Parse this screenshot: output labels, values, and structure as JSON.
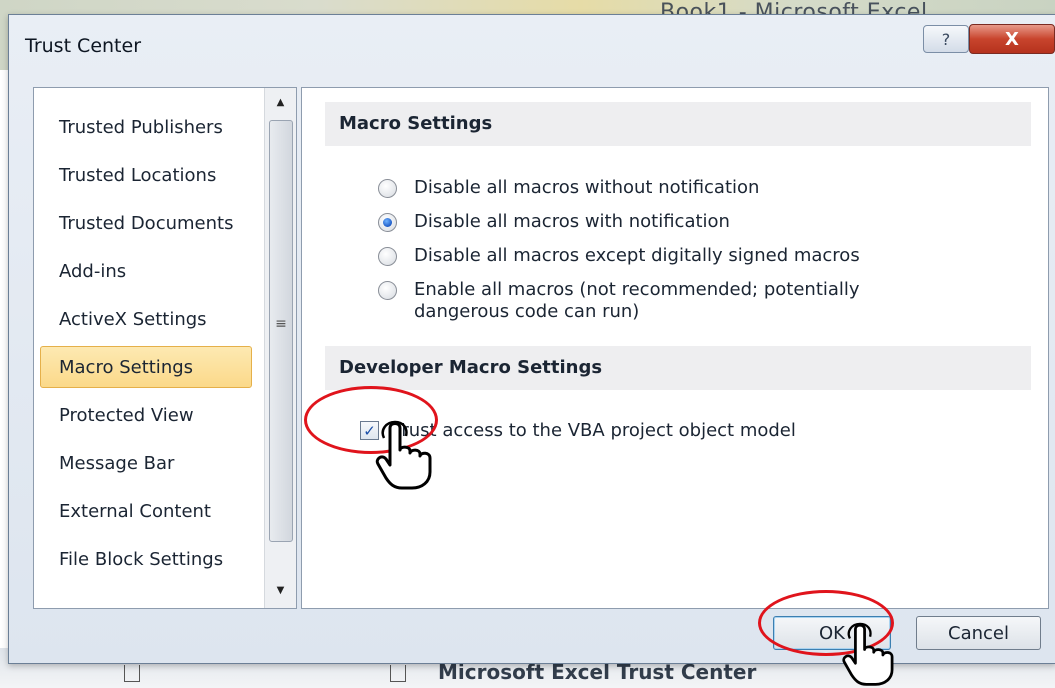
{
  "background": {
    "app_title": "Book1 - Microsoft Excel",
    "bottom_title": "Microsoft Excel Trust Center"
  },
  "dialog": {
    "title": "Trust Center",
    "help_label": "?",
    "close_label": "X"
  },
  "nav": {
    "items": [
      {
        "label": "Trusted Publishers"
      },
      {
        "label": "Trusted Locations"
      },
      {
        "label": "Trusted Documents"
      },
      {
        "label": "Add-ins"
      },
      {
        "label": "ActiveX Settings"
      },
      {
        "label": "Macro Settings"
      },
      {
        "label": "Protected View"
      },
      {
        "label": "Message Bar"
      },
      {
        "label": "External Content"
      },
      {
        "label": "File Block Settings"
      }
    ],
    "selected_index": 5
  },
  "panel": {
    "macro_header": "Macro Settings",
    "macro_options": [
      {
        "label": "Disable all macros without notification",
        "checked": false
      },
      {
        "label": "Disable all macros with notification",
        "checked": true
      },
      {
        "label": "Disable all macros except digitally signed macros",
        "checked": false
      },
      {
        "label": "Enable all macros (not recommended; potentially dangerous code can run)",
        "checked": false
      }
    ],
    "dev_header": "Developer Macro Settings",
    "vba_checkbox": {
      "label": "Trust access to the VBA project object model",
      "checked": true
    }
  },
  "buttons": {
    "ok": "OK",
    "cancel": "Cancel"
  },
  "colors": {
    "annotation_ring": "#e0141c",
    "selected_nav": "#fbd98a",
    "close_button": "#c8442d"
  },
  "icons": {
    "cursor": "hand-pointer-icon",
    "help": "question-icon",
    "close": "close-icon"
  }
}
